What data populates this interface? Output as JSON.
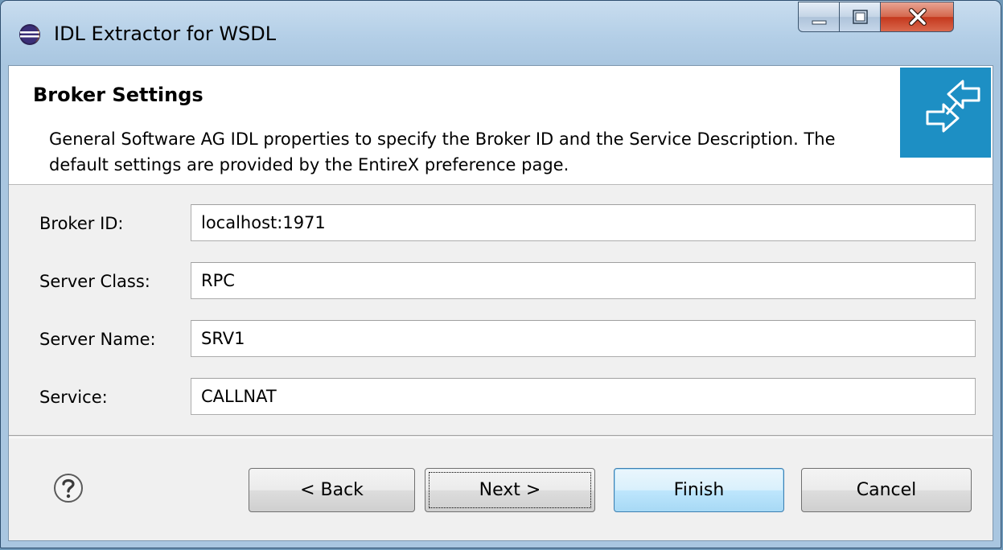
{
  "window": {
    "title": "IDL Extractor for WSDL"
  },
  "header": {
    "title": "Broker Settings",
    "description": "General Software AG IDL properties to specify the Broker ID and the Service Description. The default settings are provided by the EntireX preference page."
  },
  "fields": [
    {
      "label": "Broker ID:",
      "value": "localhost:1971"
    },
    {
      "label": "Server Class:",
      "value": "RPC"
    },
    {
      "label": "Server Name:",
      "value": "SRV1"
    },
    {
      "label": "Service:",
      "value": "CALLNAT"
    }
  ],
  "buttons": {
    "back": "< Back",
    "next": "Next >",
    "finish": "Finish",
    "cancel": "Cancel"
  },
  "icons": {
    "title": "eclipse-icon",
    "help": "help-icon",
    "banner": "exchange-arrows-icon"
  },
  "colors": {
    "banner": "#1d8fc4",
    "close_button": "#c4381d"
  }
}
